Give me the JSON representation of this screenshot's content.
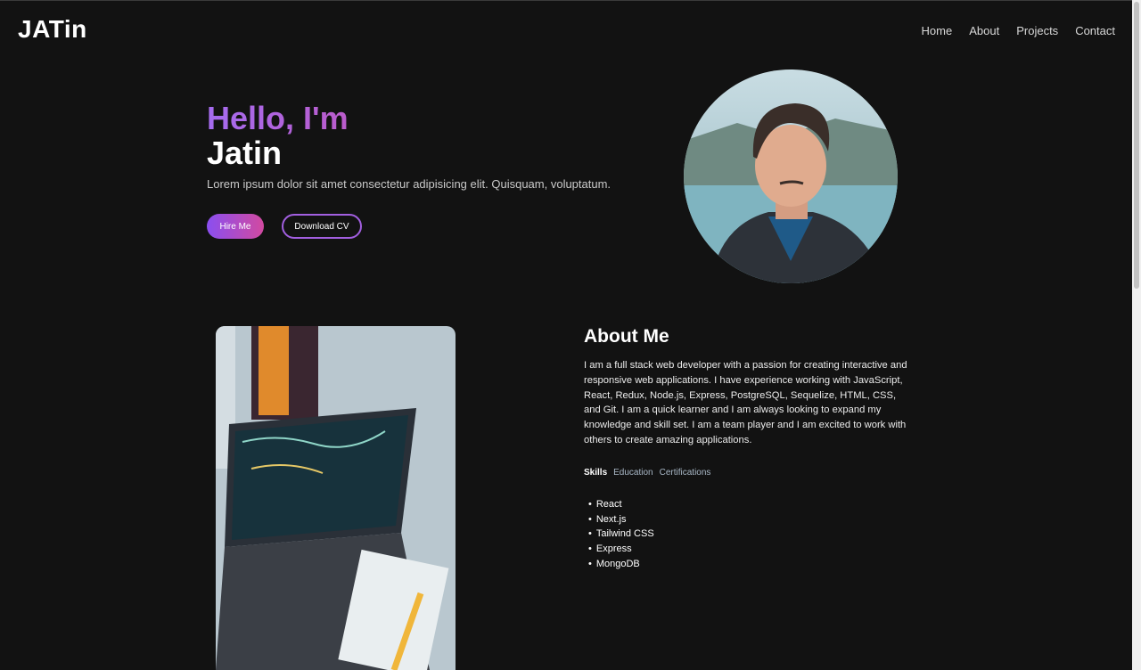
{
  "brand": "JATin",
  "nav": [
    "Home",
    "About",
    "Projects",
    "Contact"
  ],
  "hero": {
    "greeting": "Hello, I'm",
    "name": "Jatin",
    "lead": "Lorem ipsum dolor sit amet consectetur adipisicing elit. Quisquam, voluptatum.",
    "hire_label": "Hire Me",
    "cv_label": "Download CV"
  },
  "about": {
    "title": "About Me",
    "body": "I am a full stack web developer with a passion for creating interactive and responsive web applications. I have experience working with JavaScript, React, Redux, Node.js, Express, PostgreSQL, Sequelize, HTML, CSS, and Git. I am a quick learner and I am always looking to expand my knowledge and skill set. I am a team player and I am excited to work with others to create amazing applications.",
    "tabs": [
      "Skills",
      "Education",
      "Certifications"
    ],
    "skills": [
      "React",
      "Next.js",
      "Tailwind CSS",
      "Express",
      "MongoDB"
    ]
  },
  "colors": {
    "background": "#121212",
    "accent_purple": "#a56cf0",
    "accent_pink": "#e23d86"
  }
}
